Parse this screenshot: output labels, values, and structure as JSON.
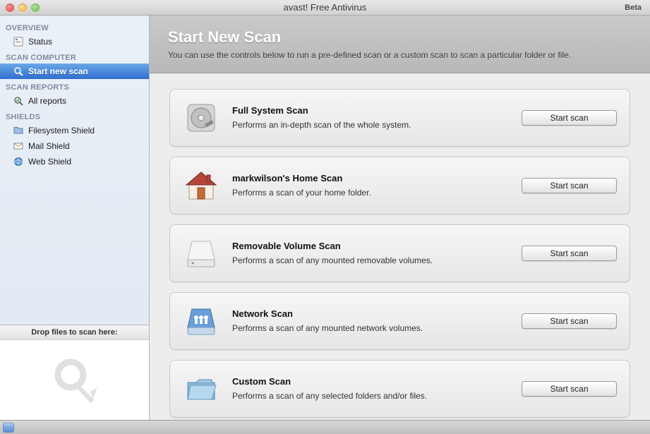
{
  "titlebar": {
    "title": "avast! Free Antivirus",
    "beta": "Beta"
  },
  "sidebar": {
    "sections": [
      {
        "header": "OVERVIEW",
        "items": [
          {
            "label": "Status",
            "icon": "status-icon",
            "active": false
          }
        ]
      },
      {
        "header": "SCAN COMPUTER",
        "items": [
          {
            "label": "Start new scan",
            "icon": "magnifier-icon",
            "active": true
          }
        ]
      },
      {
        "header": "SCAN REPORTS",
        "items": [
          {
            "label": "All reports",
            "icon": "magnifier-check-icon",
            "active": false
          }
        ]
      },
      {
        "header": "SHIELDS",
        "items": [
          {
            "label": "Filesystem Shield",
            "icon": "folder-shield-icon",
            "active": false
          },
          {
            "label": "Mail Shield",
            "icon": "mail-shield-icon",
            "active": false
          },
          {
            "label": "Web Shield",
            "icon": "web-shield-icon",
            "active": false
          }
        ]
      }
    ],
    "dropzone_label": "Drop files to scan here:"
  },
  "main": {
    "title": "Start New Scan",
    "subtitle": "You can use the controls below to run a pre-defined scan or a custom scan to scan a particular folder or file.",
    "scans": [
      {
        "title": "Full System Scan",
        "desc": "Performs an in-depth scan of the whole system.",
        "button": "Start scan",
        "icon": "harddrive-icon"
      },
      {
        "title": "markwilson's Home Scan",
        "desc": "Performs a scan of your home folder.",
        "button": "Start scan",
        "icon": "house-icon"
      },
      {
        "title": "Removable Volume Scan",
        "desc": "Performs a scan of any mounted removable volumes.",
        "button": "Start scan",
        "icon": "removable-drive-icon"
      },
      {
        "title": "Network Scan",
        "desc": "Performs a scan of any mounted network volumes.",
        "button": "Start scan",
        "icon": "network-drive-icon"
      },
      {
        "title": "Custom Scan",
        "desc": "Performs a scan of any selected folders and/or files.",
        "button": "Start scan",
        "icon": "folder-open-icon"
      }
    ]
  }
}
